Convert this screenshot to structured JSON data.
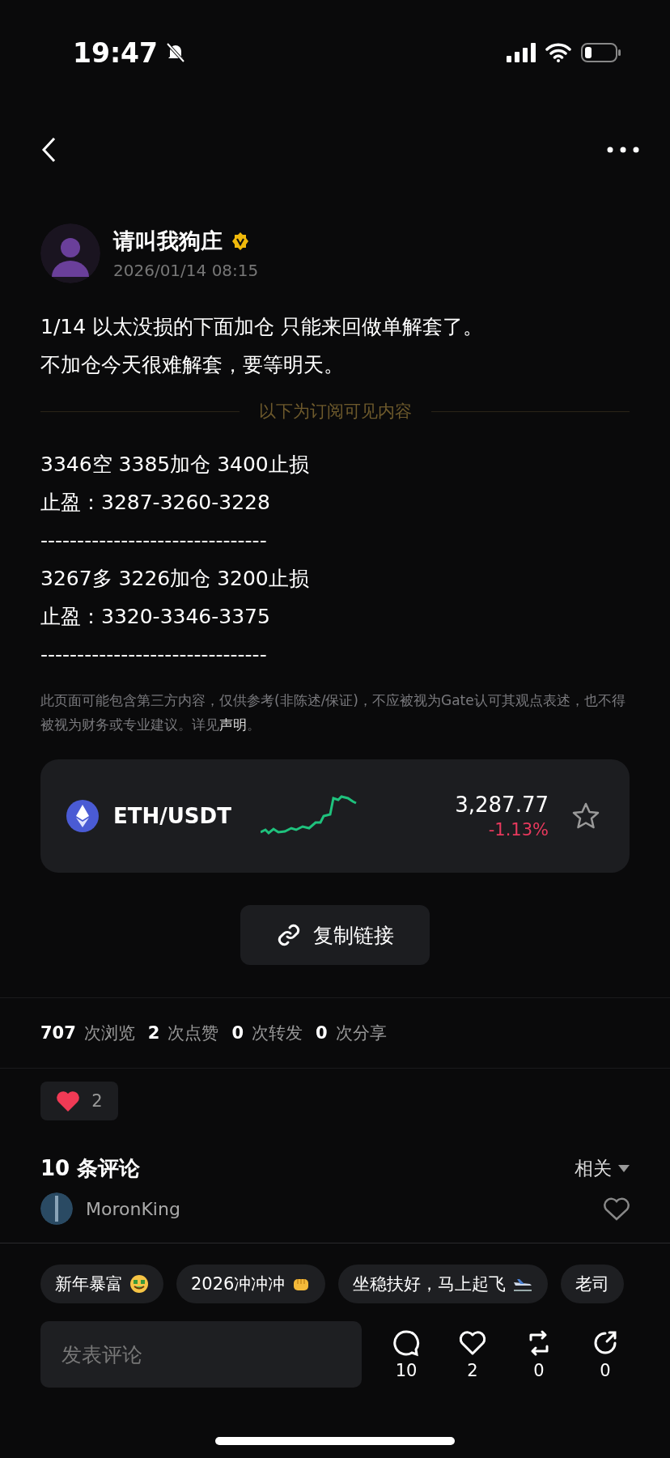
{
  "status_bar": {
    "time": "19:47",
    "silent": true
  },
  "post": {
    "author": "请叫我狗庄",
    "verified": true,
    "date": "2026/01/14 08:15",
    "text_lines": [
      "1/14  以太没损的下面加仓 只能来回做单解套了。",
      "不加仓今天很难解套，要等明天。"
    ],
    "subscriber_divider": "以下为订阅可见内容",
    "subscriber_lines": [
      "3346空  3385加仓 3400止损",
      "止盈：3287-3260-3228",
      "-------------------------------",
      "3267多 3226加仓 3200止损",
      "止盈：3320-3346-3375",
      "-------------------------------"
    ],
    "disclaimer": "此页面可能包含第三方内容，仅供参考(非陈述/保证)，不应被视为Gate认可其观点表述，也不得被视为财务或专业建议。详见",
    "disclaimer_link": "声明",
    "disclaimer_end": "。"
  },
  "ticker": {
    "pair": "ETH/USDT",
    "price": "3,287.77",
    "change": "-1.13%",
    "favorite": false
  },
  "copy_link": "复制链接",
  "stats": [
    {
      "count": "707",
      "label": "次浏览"
    },
    {
      "count": "2",
      "label": "次点赞"
    },
    {
      "count": "0",
      "label": "次转发"
    },
    {
      "count": "0",
      "label": "次分享"
    }
  ],
  "reaction": {
    "count": "2"
  },
  "comments": {
    "title": "10 条评论",
    "sort": "相关",
    "first_author": "MoronKing"
  },
  "quick_replies": [
    {
      "text": "新年暴富",
      "kind": "money"
    },
    {
      "text": "2026冲冲冲",
      "kind": "fist"
    },
    {
      "text": "坐稳扶好，马上起飞",
      "kind": "plane"
    },
    {
      "text": "老司",
      "kind": "plain"
    }
  ],
  "composer": {
    "placeholder": "发表评论"
  },
  "actions": [
    {
      "kind": "comment",
      "count": "10"
    },
    {
      "kind": "like",
      "count": "2"
    },
    {
      "kind": "repost",
      "count": "0"
    },
    {
      "kind": "share",
      "count": "0"
    }
  ]
}
